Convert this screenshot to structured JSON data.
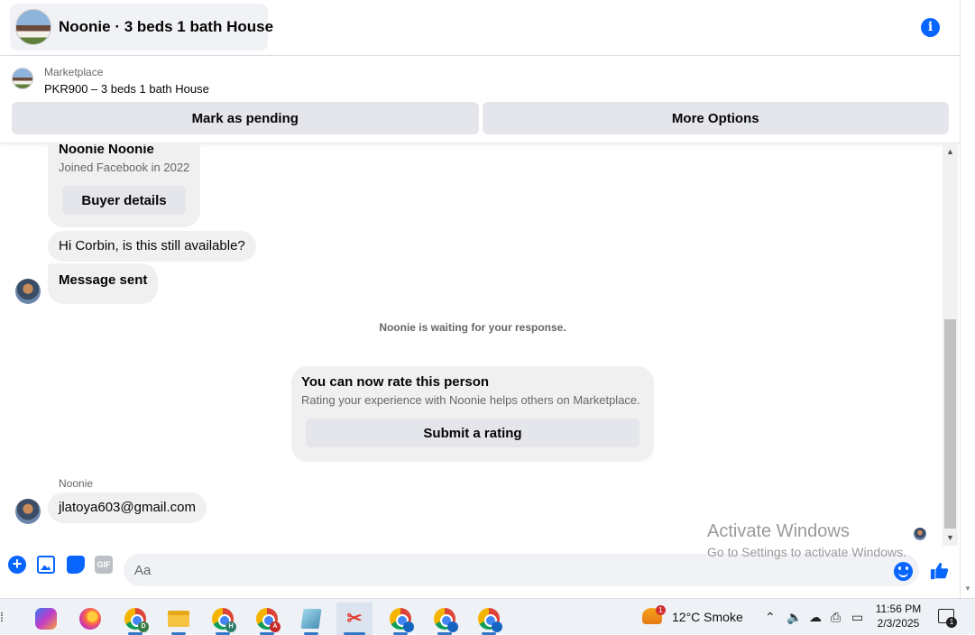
{
  "header": {
    "title": "Noonie · 3 beds 1 bath House",
    "info_icon": "info-icon"
  },
  "listing": {
    "label": "Marketplace",
    "title": "PKR900 – 3 beds 1 bath House",
    "mark_pending_label": "Mark as pending",
    "more_options_label": "More Options"
  },
  "chat": {
    "buyer_card": {
      "name": "Noonie Noonie",
      "joined": "Joined Facebook in 2022",
      "button_label": "Buyer details"
    },
    "messages": [
      {
        "text": "Hi Corbin, is this still available?"
      },
      {
        "text": "Message sent"
      }
    ],
    "waiting_text": "Noonie is waiting for your response.",
    "rating_card": {
      "title": "You can now rate this person",
      "description": "Rating your experience with Noonie helps others on Marketplace.",
      "button_label": "Submit a rating"
    },
    "sender_label": "Noonie",
    "last_message": "jlatoya603@gmail.com"
  },
  "composer": {
    "placeholder": "Aa",
    "gif_label": "GIF"
  },
  "watermark": {
    "title": "Activate Windows",
    "subtitle": "Go to Settings to activate Windows."
  },
  "taskbar": {
    "apps": [
      {
        "name": "copilot"
      },
      {
        "name": "firefox"
      },
      {
        "name": "chrome",
        "badge": "D",
        "badge_color": "#3a7d44"
      },
      {
        "name": "file-explorer"
      },
      {
        "name": "chrome",
        "badge": "H",
        "badge_color": "#2e7d6b"
      },
      {
        "name": "chrome",
        "badge": "A",
        "badge_color": "#c62828"
      },
      {
        "name": "notepad"
      },
      {
        "name": "snipping-tool"
      },
      {
        "name": "chrome",
        "badge": "",
        "badge_color": "#1565c0"
      },
      {
        "name": "chrome",
        "badge": "",
        "badge_color": "#1565c0"
      },
      {
        "name": "chrome",
        "badge": "",
        "badge_color": "#1565c0"
      }
    ],
    "weather_badge": "1",
    "weather": "12°C  Smoke",
    "time": "11:56 PM",
    "date": "2/3/2025",
    "notification_count": "1"
  },
  "colors": {
    "accent": "#0866ff",
    "bubble": "#f0f0f0",
    "button": "#e4e6eb"
  }
}
